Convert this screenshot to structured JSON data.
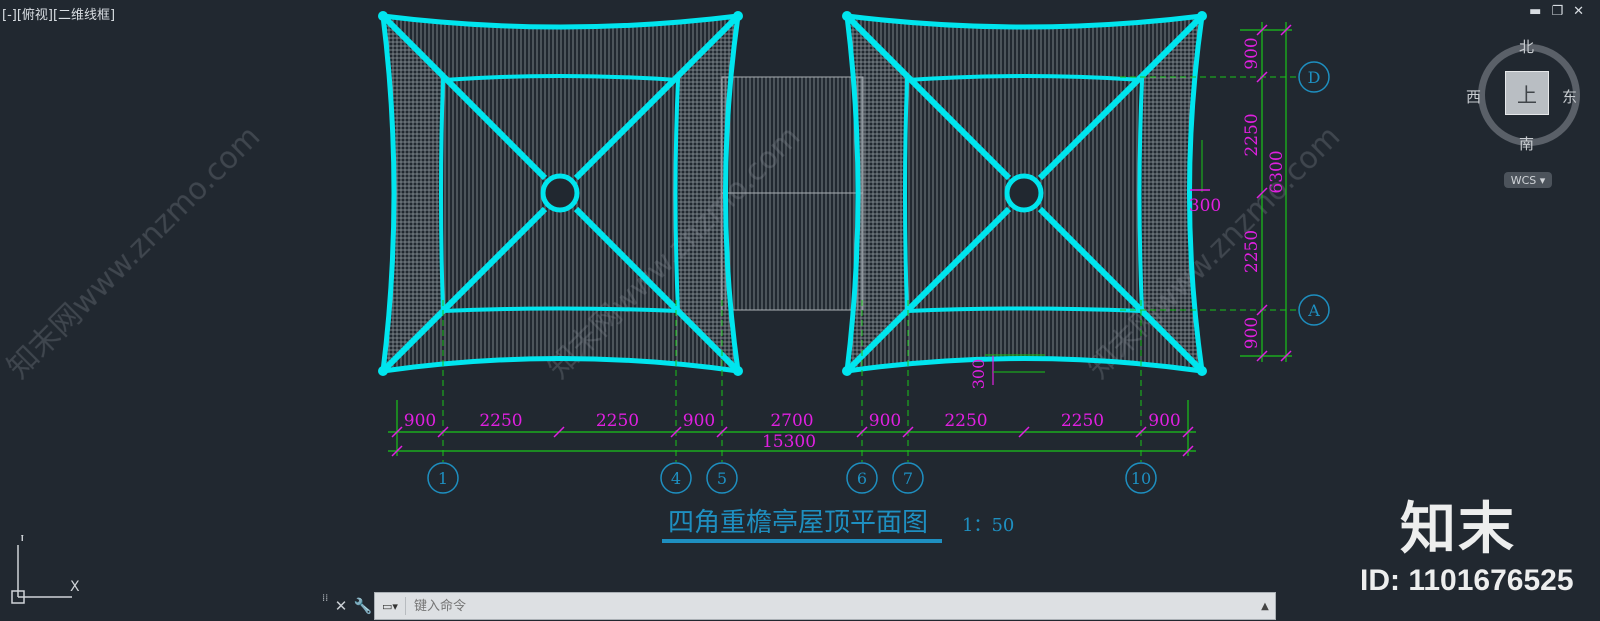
{
  "viewport": {
    "label": "[-][俯视][二维线框]"
  },
  "window_controls": {
    "minimize": "▬",
    "restore": "❐",
    "close": "✕"
  },
  "viewcube": {
    "north": "北",
    "south": "南",
    "east": "东",
    "west": "西",
    "face": "上",
    "wcs": "WCS ▾"
  },
  "ucs": {
    "x": "X",
    "y": "Y"
  },
  "drawing": {
    "title": "四角重檐亭屋顶平面图",
    "scale": "1：50",
    "horizontal_dims": [
      "900",
      "2250",
      "2250",
      "900",
      "2700",
      "900",
      "2250",
      "2250",
      "900"
    ],
    "total_width": "15300",
    "vertical_dims": [
      "900",
      "2250",
      "2250",
      "900"
    ],
    "total_height": "6300",
    "offset_dim": "300",
    "column_axes": [
      "1",
      "4",
      "5",
      "6",
      "7",
      "10"
    ],
    "row_axes": [
      "D",
      "A"
    ],
    "watermark_text": "知末网www.znzmo.com"
  },
  "watermark": {
    "logo": "知末",
    "id": "ID: 1101676525"
  },
  "command": {
    "placeholder": "键入命令",
    "close_icon": "close-icon",
    "settings_icon": "wrench-icon"
  },
  "colors": {
    "background": "#212830",
    "roof": "#00e5ee",
    "dimension": "#e020e0",
    "axis": "#1e8fc0",
    "grid_green": "#19c419"
  }
}
